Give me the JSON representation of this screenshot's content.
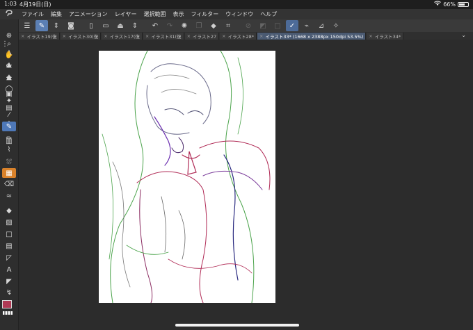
{
  "status": {
    "time": "1:03",
    "date": "4月19日(日)",
    "battery": "66%",
    "battery_level": 0.66
  },
  "menu": [
    "ファイル",
    "編集",
    "アニメーション",
    "レイヤー",
    "選択範囲",
    "表示",
    "フィルター",
    "ウィンドウ",
    "ヘルプ"
  ],
  "tabs": [
    "イラスト19(復",
    "イラスト30(復",
    "イラスト17(復",
    "イラスト31(復",
    "イラスト27",
    "イラスト28*",
    "イラスト33* (1668 x 2388px 150dpi 53.5%)",
    "イラスト34*"
  ],
  "icons": {
    "app_logo": "clip-studio-logo-icon",
    "wifi": "wifi-icon",
    "tab_close": "close-icon",
    "tab_menu": "chevron-down-icon"
  },
  "colors": {
    "accent": "#4e78b8",
    "main_color": "#b03a55",
    "active_tab": "#4a5a72"
  }
}
